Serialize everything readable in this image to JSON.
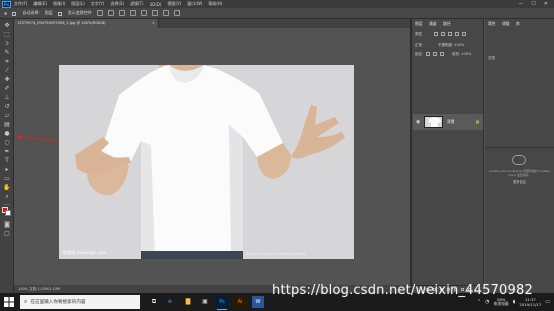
{
  "app": {
    "logo_text": "Ps",
    "menu": [
      "文件(F)",
      "编辑(E)",
      "图像(I)",
      "图层(L)",
      "文字(Y)",
      "选择(S)",
      "滤镜(T)",
      "3D(D)",
      "视图(V)",
      "窗口(W)",
      "帮助(H)"
    ],
    "window_controls": [
      "—",
      "☐",
      "✕"
    ]
  },
  "options_bar": {
    "auto_select_label": "自动选择:",
    "auto_select_value": "图层",
    "show_transform_label": "显示变换控件"
  },
  "document": {
    "tab_title": "13379974_094750597006_2.jpg @ 100%(RGB/8)",
    "close": "×",
    "watermark_left": "昵图网 www.nipic.com",
    "watermark_right": "By:Wxl No:20191116092045384000"
  },
  "layers_panel": {
    "tabs": [
      "图层",
      "通道",
      "路径"
    ],
    "kind_label": "类型",
    "blend_mode": "正常",
    "opacity_label": "不透明度: 100%",
    "lock_label": "锁定:",
    "fill_label": "填充: 100%",
    "layer": {
      "name": "背景",
      "lock_icon": "🔒"
    }
  },
  "properties_panel": {
    "tabs": [
      "属性",
      "调整",
      "库"
    ],
    "label": "文档",
    "library_message": "Creative Cloud Libraries 需要有效的 Creative Cloud 会员资格。",
    "library_link": "更多信息"
  },
  "status_bar": {
    "text": "100%     文档:1.03M/1.03M"
  },
  "taskbar": {
    "search_placeholder": "在这里输入你要搜索的内容",
    "battery": "56%",
    "battery_label": "电池电量",
    "time": "11:37",
    "date": "2019/11/17"
  },
  "overlay": {
    "url": "https://blog.csdn.net/weixin_44570982"
  },
  "colors": {
    "foreground": "#ff0000",
    "background": "#ffffff",
    "arrow": "#d9261c"
  }
}
